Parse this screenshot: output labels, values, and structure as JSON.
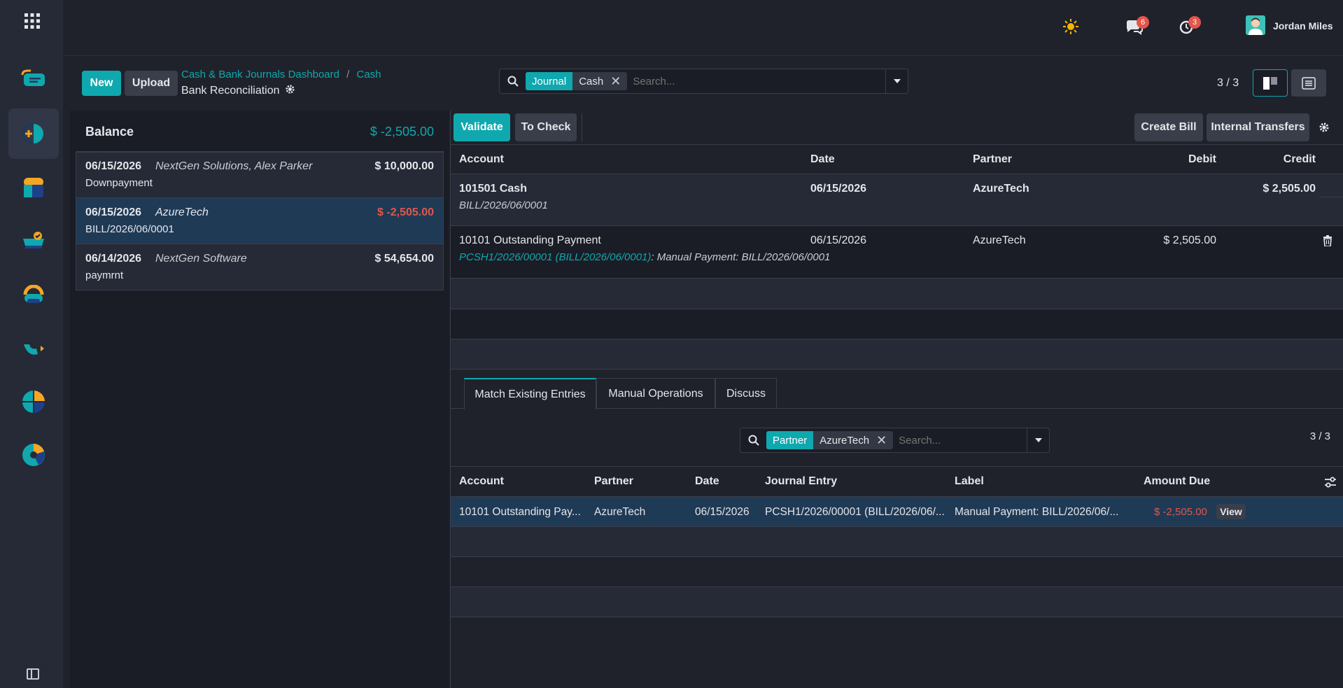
{
  "topbar": {
    "user_name": "Jordan Miles",
    "messages_count": "6",
    "activities_count": "3"
  },
  "sidebar": {
    "apps": [
      "invoicing-app-icon",
      "accounting-app-icon",
      "sales-app-icon",
      "purchase-app-icon",
      "contacts-app-icon",
      "project-app-icon",
      "dashboard-app-icon",
      "analytics-app-icon"
    ]
  },
  "control": {
    "new_label": "New",
    "upload_label": "Upload",
    "breadcrumb_1": "Cash & Bank Journals Dashboard",
    "breadcrumb_sep": "/",
    "breadcrumb_2": "Cash",
    "page_title": "Bank Reconciliation",
    "search_facet_name": "Journal",
    "search_facet_value": "Cash",
    "search_placeholder": "Search...",
    "pager": "3 / 3"
  },
  "left": {
    "balance_label": "Balance",
    "balance_value": "$ -2,505.00",
    "lines": [
      {
        "date": "06/15/2026",
        "partner": "NextGen Solutions, Alex Parker",
        "amount": "$ 10,000.00",
        "label": "Downpayment",
        "negative": false
      },
      {
        "date": "06/15/2026",
        "partner": "AzureTech",
        "amount": "$ -2,505.00",
        "label": "BILL/2026/06/0001",
        "negative": true
      },
      {
        "date": "06/14/2026",
        "partner": "NextGen Software",
        "amount": "$ 54,654.00",
        "label": "paymrnt",
        "negative": false
      }
    ]
  },
  "right": {
    "validate_label": "Validate",
    "to_check_label": "To Check",
    "create_bill_label": "Create Bill",
    "internal_transfers_label": "Internal Transfers",
    "headers": {
      "account": "Account",
      "date": "Date",
      "partner": "Partner",
      "debit": "Debit",
      "credit": "Credit"
    },
    "entries": [
      {
        "account": "101501 Cash",
        "ref": "BILL/2026/06/0001",
        "date": "06/15/2026",
        "partner": "AzureTech",
        "debit": "",
        "credit": "$ 2,505.00"
      },
      {
        "account": "10101 Outstanding Payment",
        "ref_link": "PCSH1/2026/00001 (BILL/2026/06/0001)",
        "ref_rest": ": Manual Payment: BILL/2026/06/0001",
        "date": "06/15/2026",
        "partner": "AzureTech",
        "debit": "$ 2,505.00",
        "credit": ""
      }
    ],
    "tabs": [
      "Match Existing Entries",
      "Manual Operations",
      "Discuss"
    ],
    "match_search": {
      "facet_name": "Partner",
      "facet_value": "AzureTech",
      "placeholder": "Search...",
      "pager": "3 / 3"
    },
    "match_headers": {
      "account": "Account",
      "partner": "Partner",
      "date": "Date",
      "journal_entry": "Journal Entry",
      "label": "Label",
      "amount_due": "Amount Due"
    },
    "match_rows": [
      {
        "account": "10101 Outstanding Pay...",
        "partner": "AzureTech",
        "date": "06/15/2026",
        "journal_entry": "PCSH1/2026/00001 (BILL/2026/06/...",
        "label": "Manual Payment: BILL/2026/06/...",
        "amount_due": "$ -2,505.00",
        "view_label": "View"
      }
    ]
  },
  "colors": {
    "accent": "#0fa8ae",
    "negative": "#e2564c",
    "selected_row": "#1f3a55"
  }
}
